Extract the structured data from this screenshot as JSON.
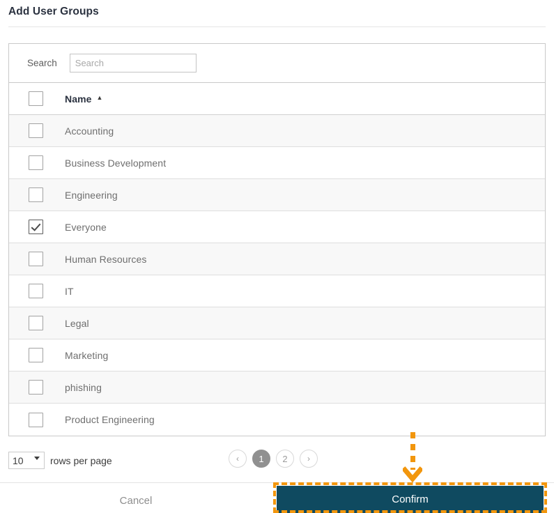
{
  "dialog": {
    "title": "Add User Groups"
  },
  "search": {
    "label": "Search",
    "placeholder": "Search",
    "value": ""
  },
  "table": {
    "header": {
      "name_label": "Name",
      "sort_caret": "▲"
    },
    "rows": [
      {
        "name": "Accounting",
        "checked": false
      },
      {
        "name": "Business Development",
        "checked": false
      },
      {
        "name": "Engineering",
        "checked": false
      },
      {
        "name": "Everyone",
        "checked": true
      },
      {
        "name": "Human Resources",
        "checked": false
      },
      {
        "name": "IT",
        "checked": false
      },
      {
        "name": "Legal",
        "checked": false
      },
      {
        "name": "Marketing",
        "checked": false
      },
      {
        "name": "phishing",
        "checked": false
      },
      {
        "name": "Product Engineering",
        "checked": false
      }
    ]
  },
  "pagination": {
    "rows_per_page_value": "10",
    "rows_per_page_options": [
      "10"
    ],
    "rows_per_page_label": "rows per page",
    "prev_icon": "‹",
    "next_icon": "›",
    "pages": [
      "1",
      "2"
    ],
    "active_page": "1"
  },
  "footer": {
    "cancel_label": "Cancel",
    "confirm_label": "Confirm"
  },
  "colors": {
    "confirm_background": "#0f4a60",
    "annotation": "#f2960d",
    "title_text": "#2b3240",
    "row_text": "#6e6e6e",
    "active_page_background": "#909090"
  }
}
